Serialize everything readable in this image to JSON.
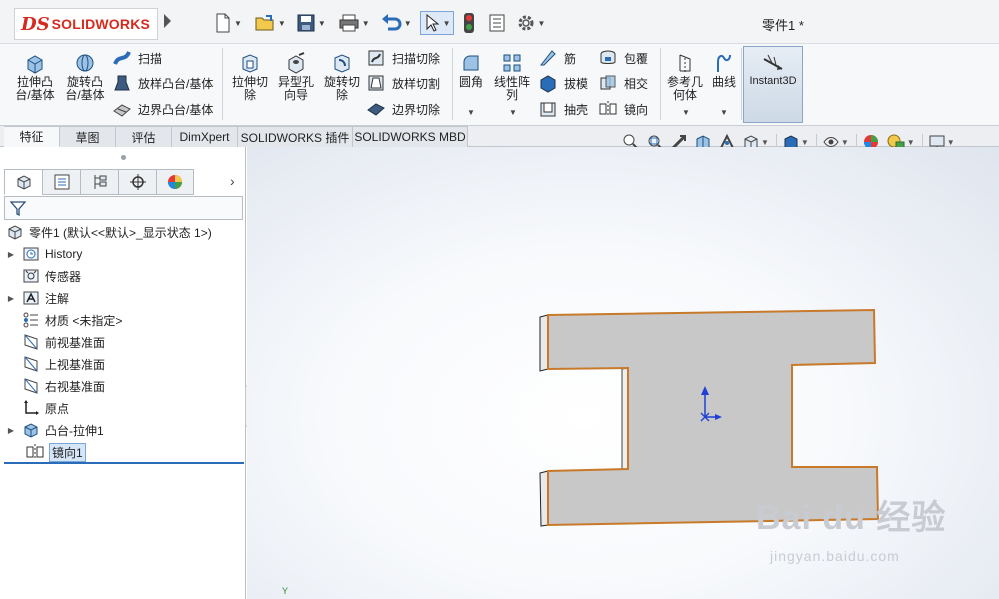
{
  "app": {
    "logo_mark": "DS",
    "logo_text": "SOLIDWORKS",
    "document_title": "零件1 *"
  },
  "quick_access": [
    {
      "name": "new-doc-icon"
    },
    {
      "name": "open-folder-icon"
    },
    {
      "name": "save-icon"
    },
    {
      "name": "print-icon"
    },
    {
      "name": "undo-icon"
    },
    {
      "name": "select-pointer-icon"
    },
    {
      "name": "rebuild-traffic-light-icon"
    },
    {
      "name": "file-properties-icon"
    },
    {
      "name": "options-gear-icon"
    }
  ],
  "ribbon": {
    "extruded_boss": "拉伸凸\n台/基体",
    "revolved_boss": "旋转凸\n台/基体",
    "sweep": "扫描",
    "loft": "放样凸台/基体",
    "boundary_boss": "边界凸台/基体",
    "extruded_cut": "拉伸切\n除",
    "hole_wizard": "异型孔\n向导",
    "revolved_cut": "旋转切\n除",
    "swept_cut": "扫描切除",
    "lofted_cut": "放样切割",
    "boundary_cut": "边界切除",
    "fillet": "圆角",
    "linear_pattern": "线性阵\n列",
    "rib": "筋",
    "draft": "拔模",
    "shell": "抽壳",
    "wrap": "包覆",
    "intersect": "相交",
    "mirror": "镜向",
    "reference_geometry": "参考几\n何体",
    "curves": "曲线",
    "instant3d": "Instant3D"
  },
  "tabs": [
    {
      "label": "特征",
      "active": true
    },
    {
      "label": "草图",
      "active": false
    },
    {
      "label": "评估",
      "active": false
    },
    {
      "label": "DimXpert",
      "active": false
    },
    {
      "label": "SOLIDWORKS 插件",
      "active": false
    },
    {
      "label": "SOLIDWORKS MBD",
      "active": false
    }
  ],
  "feature_manager": {
    "panel_tabs": [
      "feature-manager-tab",
      "property-manager-tab",
      "configuration-manager-tab",
      "dimxpert-manager-tab",
      "display-manager-tab"
    ],
    "tree": [
      {
        "label": "零件1  (默认<<默认>_显示状态 1>)",
        "icon": "part-icon",
        "expandable": false,
        "selected": false
      },
      {
        "label": "History",
        "icon": "history-folder-icon",
        "expandable": true,
        "selected": false
      },
      {
        "label": "传感器",
        "icon": "sensor-icon",
        "expandable": false,
        "selected": false
      },
      {
        "label": "注解",
        "icon": "annotations-icon",
        "expandable": true,
        "selected": false
      },
      {
        "label": "材质 <未指定>",
        "icon": "material-icon",
        "expandable": false,
        "selected": false
      },
      {
        "label": "前视基准面",
        "icon": "plane-icon",
        "expandable": false,
        "selected": false
      },
      {
        "label": "上视基准面",
        "icon": "plane-icon",
        "expandable": false,
        "selected": false
      },
      {
        "label": "右视基准面",
        "icon": "plane-icon",
        "expandable": false,
        "selected": false
      },
      {
        "label": "原点",
        "icon": "origin-icon",
        "expandable": false,
        "selected": false
      },
      {
        "label": "凸台-拉伸1",
        "icon": "extrude-feature-icon",
        "expandable": true,
        "selected": false
      },
      {
        "label": "镜向1",
        "icon": "mirror-feature-icon",
        "expandable": false,
        "selected": true
      }
    ]
  },
  "viewport": {
    "model_fill": "#c8c8c8",
    "edge_color": "#c87a2a",
    "triad_label": "Y"
  },
  "watermark": {
    "text": "Bai du 经验",
    "sub": "jingyan.baidu.com"
  }
}
